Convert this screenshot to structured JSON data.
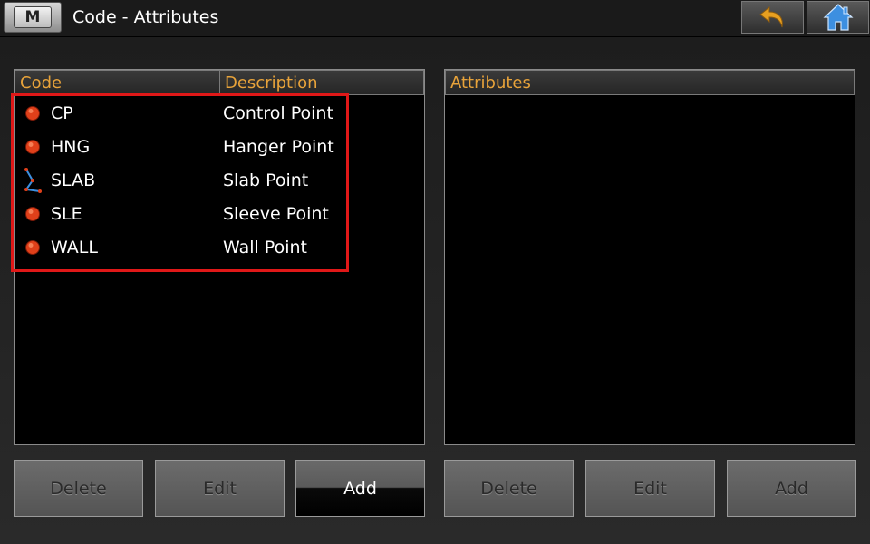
{
  "titlebar": {
    "menu_label": "M",
    "title": "Code - Attributes",
    "undo_icon": "undo-arrow-icon",
    "home_icon": "home-icon"
  },
  "code_panel": {
    "headers": {
      "code": "Code",
      "description": "Description"
    },
    "rows": [
      {
        "code": "CP",
        "description": "Control Point",
        "icon": "point-icon"
      },
      {
        "code": "HNG",
        "description": "Hanger Point",
        "icon": "point-icon"
      },
      {
        "code": "SLAB",
        "description": "Slab Point",
        "icon": "polyline-icon"
      },
      {
        "code": "SLE",
        "description": "Sleeve Point",
        "icon": "point-icon"
      },
      {
        "code": "WALL",
        "description": "Wall Point",
        "icon": "point-icon"
      }
    ],
    "buttons": {
      "delete": "Delete",
      "edit": "Edit",
      "add": "Add"
    }
  },
  "attributes_panel": {
    "header": "Attributes",
    "buttons": {
      "delete": "Delete",
      "edit": "Edit",
      "add": "Add"
    }
  },
  "colors": {
    "header_text": "#e8a33a",
    "highlight": "#e01818",
    "point_icon": "#e0401a",
    "home_icon": "#3d8fe0",
    "undo_icon": "#e8a020"
  }
}
